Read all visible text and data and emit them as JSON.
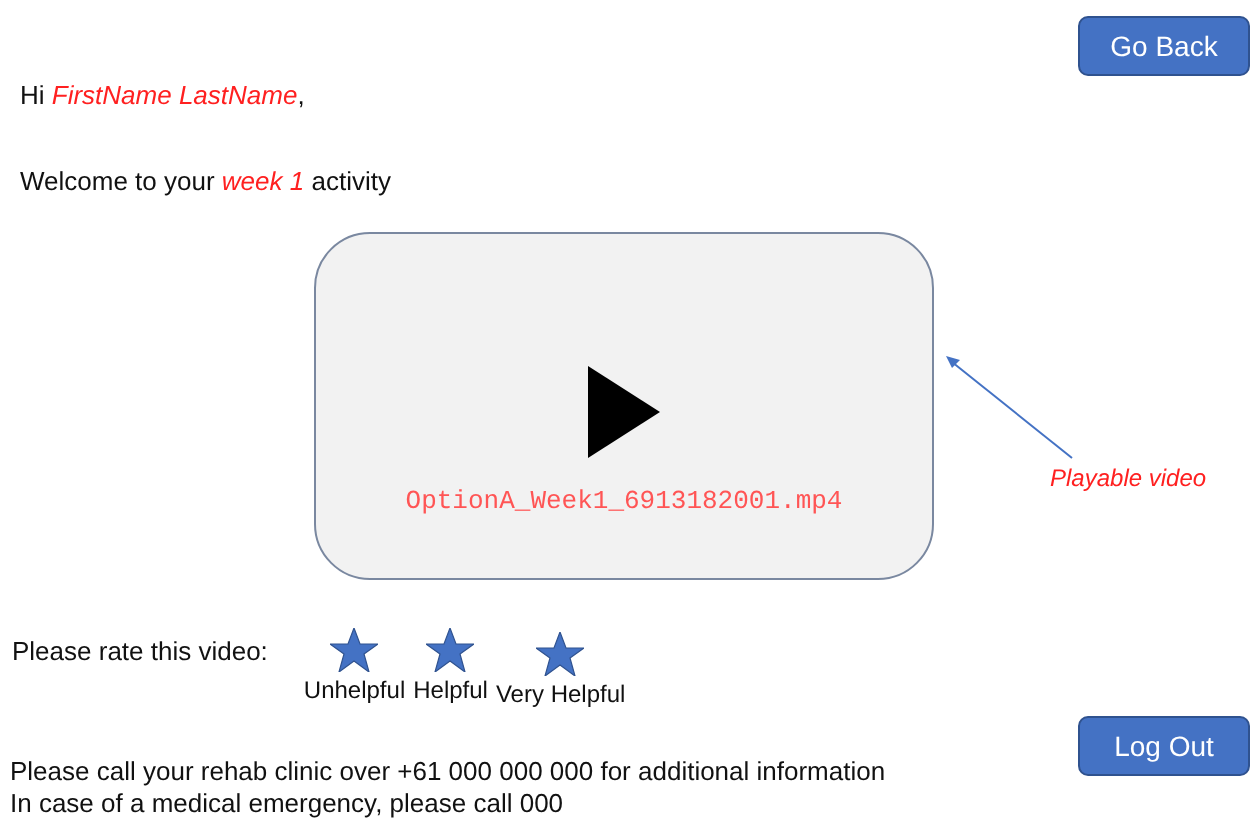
{
  "buttons": {
    "back": "Go Back",
    "logout": "Log Out"
  },
  "greeting": "Hi *FirstName LastName*,",
  "welcome": "Welcome to your *week 1* activity",
  "video": {
    "filename": "OptionA_Week1_6913182001.mp4",
    "annotation": "Playable video"
  },
  "rating": {
    "prompt": "Please rate this video:",
    "options": [
      {
        "label": "Unhelpful"
      },
      {
        "label": "Helpful"
      },
      {
        "label": "Very Helpful"
      }
    ]
  },
  "footer": [
    "Please call your rehab clinic over +61 000 000 000 for additional information",
    "In case of a medical emergency, please call 000"
  ]
}
